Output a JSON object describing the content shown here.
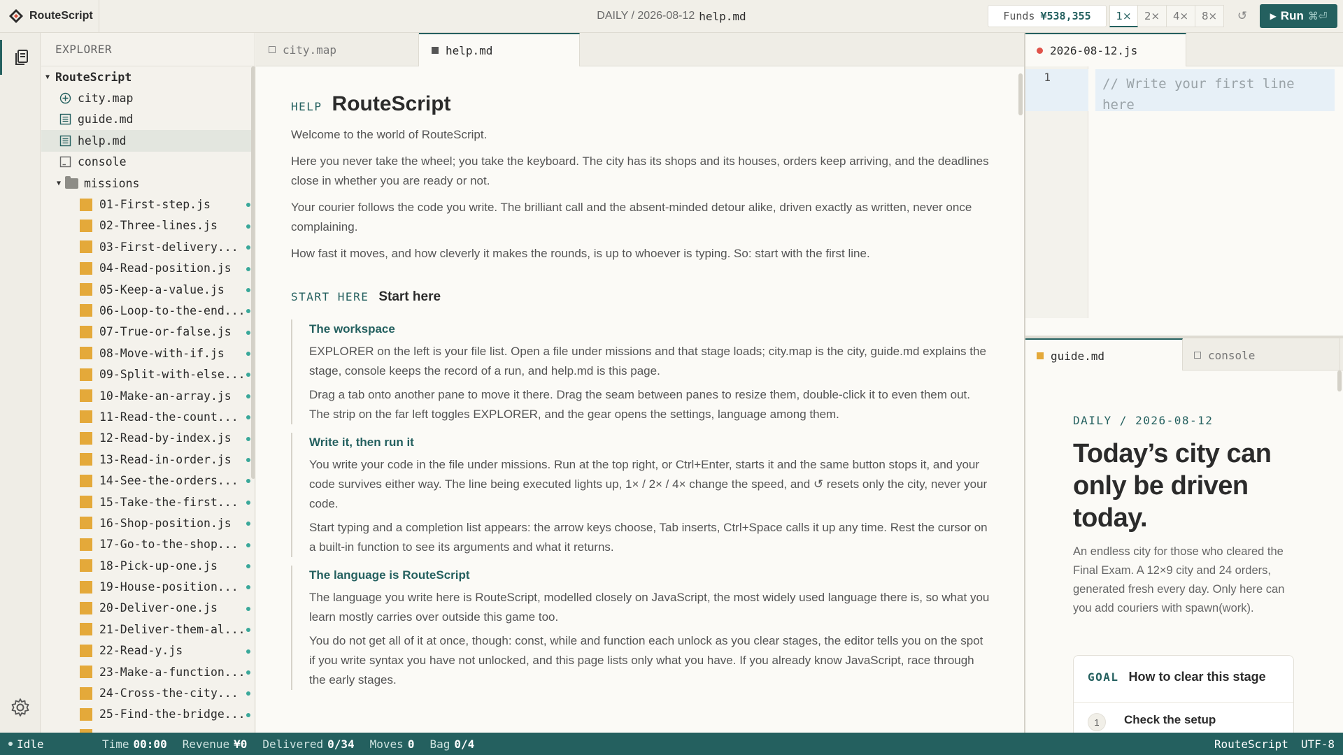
{
  "app": {
    "name": "RouteScript"
  },
  "header": {
    "doc_date": "DAILY / 2026-08-12",
    "doc_file": "help.md",
    "funds_label": "Funds",
    "funds_value": "¥538,355",
    "speeds": [
      "1×",
      "2×",
      "4×",
      "8×"
    ],
    "active_speed": "1×",
    "reset_icon": "↺",
    "run_label": "Run",
    "run_shortcut": "⌘⏎"
  },
  "explorer": {
    "header": "EXPLORER",
    "root": "RouteScript",
    "files": [
      {
        "name": "city.map",
        "icon": "map-icon"
      },
      {
        "name": "guide.md",
        "icon": "doc-icon"
      },
      {
        "name": "help.md",
        "icon": "doc-icon",
        "selected": true
      },
      {
        "name": "console",
        "icon": "console-icon"
      }
    ],
    "folder": "missions",
    "missions": [
      "01-First-step.js",
      "02-Three-lines.js",
      "03-First-delivery...",
      "04-Read-position.js",
      "05-Keep-a-value.js",
      "06-Loop-to-the-end...",
      "07-True-or-false.js",
      "08-Move-with-if.js",
      "09-Split-with-else...",
      "10-Make-an-array.js",
      "11-Read-the-count...",
      "12-Read-by-index.js",
      "13-Read-in-order.js",
      "14-See-the-orders...",
      "15-Take-the-first...",
      "16-Shop-position.js",
      "17-Go-to-the-shop...",
      "18-Pick-up-one.js",
      "19-House-position...",
      "20-Deliver-one.js",
      "21-Deliver-them-al...",
      "22-Read-y.js",
      "23-Make-a-function...",
      "24-Cross-the-city...",
      "25-Find-the-bridge..."
    ]
  },
  "center_tabs": [
    {
      "label": "city.map",
      "active": false
    },
    {
      "label": "help.md",
      "active": true
    }
  ],
  "help": {
    "tag": "HELP",
    "title": "RouteScript",
    "intro": [
      "Welcome to the world of RouteScript.",
      "Here you never take the wheel; you take the keyboard. The city has its shops and its houses, orders keep arriving, and the deadlines close in whether you are ready or not.",
      "Your courier follows the code you write. The brilliant call and the absent-minded detour alike, driven exactly as written, never once complaining.",
      "How fast it moves, and how cleverly it makes the rounds, is up to whoever is typing. So: start with the first line."
    ],
    "start_tag": "START HERE",
    "start_title": "Start here",
    "blocks": [
      {
        "title": "The workspace",
        "paras": [
          "EXPLORER on the left is your file list. Open a file under missions and that stage loads; city.map is the city, guide.md explains the stage, console keeps the record of a run, and help.md is this page.",
          "Drag a tab onto another pane to move it there. Drag the seam between panes to resize them, double-click it to even them out. The strip on the far left toggles EXPLORER, and the gear opens the settings, language among them."
        ]
      },
      {
        "title": "Write it, then run it",
        "paras": [
          "You write your code in the file under missions. Run at the top right, or Ctrl+Enter, starts it and the same button stops it, and your code survives either way. The line being executed lights up, 1× / 2× / 4× change the speed, and ↺ resets only the city, never your code.",
          "Start typing and a completion list appears: the arrow keys choose, Tab inserts, Ctrl+Space calls it up any time. Rest the cursor on a built-in function to see its arguments and what it returns."
        ]
      },
      {
        "title": "The language is RouteScript",
        "paras": [
          "The language you write here is RouteScript, modelled closely on JavaScript, the most widely used language there is, so what you learn mostly carries over outside this game too.",
          "You do not get all of it at once, though: const, while and function each unlock as you clear stages, the editor tells you on the spot if you write syntax you have not unlocked, and this page lists only what you have. If you already know JavaScript, race through the early stages."
        ]
      }
    ]
  },
  "code_editor": {
    "tab": "2026-08-12.js",
    "line_number": "1",
    "placeholder": "// Write your first line here"
  },
  "right_bottom_tabs": [
    {
      "label": "guide.md",
      "active": true
    },
    {
      "label": "console",
      "active": false
    }
  ],
  "guide": {
    "date": "DAILY / 2026-08-12",
    "title": "Today’s city can only be driven today.",
    "body": "An endless city for those who cleared the Final Exam. A 12×9 city and 24 orders, generated fresh every day. Only here can you add couriers with spawn(work).",
    "goal_tag": "GOAL",
    "goal_title": "How to clear this stage",
    "step_number": "1",
    "step_title": "Check the setup"
  },
  "status": {
    "state": "Idle",
    "time_label": "Time",
    "time_value": "00:00",
    "revenue_label": "Revenue",
    "revenue_value": "¥0",
    "delivered_label": "Delivered",
    "delivered_value": "0/34",
    "moves_label": "Moves",
    "moves_value": "0",
    "bag_label": "Bag",
    "bag_value": "0/4",
    "language": "RouteScript",
    "encoding": "UTF-8"
  },
  "colors": {
    "accent": "#24605f",
    "mission": "#e4a93a",
    "status_dot": "#3aa89a"
  }
}
